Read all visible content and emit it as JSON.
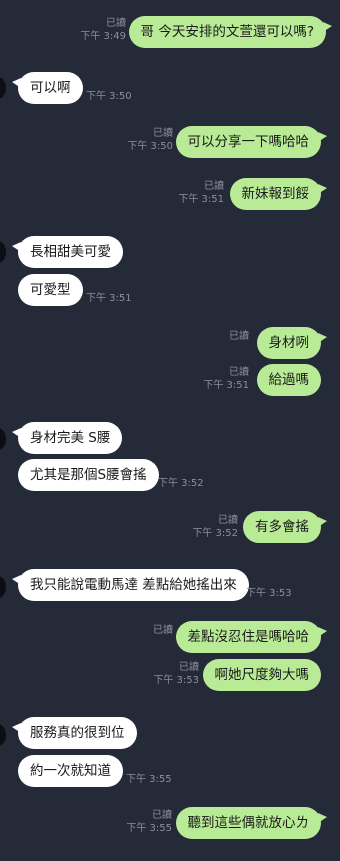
{
  "messages": [
    {
      "id": "m1",
      "side": "out",
      "text": "哥 今天安排的文萱還可以嗎?",
      "read": "已讀",
      "time": "下午 3:49"
    },
    {
      "id": "m2",
      "side": "in",
      "text": "可以啊",
      "time": "下午 3:50"
    },
    {
      "id": "m3",
      "side": "out",
      "text": "可以分享一下嗎哈哈",
      "read": "已讀",
      "time": "下午 3:50"
    },
    {
      "id": "m4",
      "side": "out",
      "text": "新妹報到餒",
      "read": "已讀",
      "time": "下午 3:51"
    },
    {
      "id": "m5",
      "side": "in",
      "text": "長相甜美可愛"
    },
    {
      "id": "m6",
      "side": "in",
      "text": "可愛型",
      "time": "下午 3:51"
    },
    {
      "id": "m7",
      "side": "out",
      "text": "身材咧",
      "read": "已讀"
    },
    {
      "id": "m8",
      "side": "out",
      "text": "給過嗎",
      "read": "已讀",
      "time": "下午 3:51"
    },
    {
      "id": "m9",
      "side": "in",
      "text": "身材完美 S腰"
    },
    {
      "id": "m10",
      "side": "in",
      "text": "尤其是那個S腰會搖",
      "time": "下午 3:52"
    },
    {
      "id": "m11",
      "side": "out",
      "text": "有多會搖",
      "read": "已讀",
      "time": "下午 3:52"
    },
    {
      "id": "m12",
      "side": "in",
      "text": "我只能說電動馬達 差點給她搖出來",
      "time": "下午 3:53"
    },
    {
      "id": "m13",
      "side": "out",
      "text": "差點沒忍住是嗎哈哈",
      "read": "已讀"
    },
    {
      "id": "m14",
      "side": "out",
      "text": "啊她尺度夠大嗎",
      "read": "已讀",
      "time": "下午 3:53"
    },
    {
      "id": "m15",
      "side": "in",
      "text": "服務真的很到位"
    },
    {
      "id": "m16",
      "side": "in",
      "text": "約一次就知道",
      "time": "下午 3:55"
    },
    {
      "id": "m17",
      "side": "out",
      "text": "聽到這些偶就放心ㄌ",
      "read": "已讀",
      "time": "下午 3:55"
    }
  ]
}
